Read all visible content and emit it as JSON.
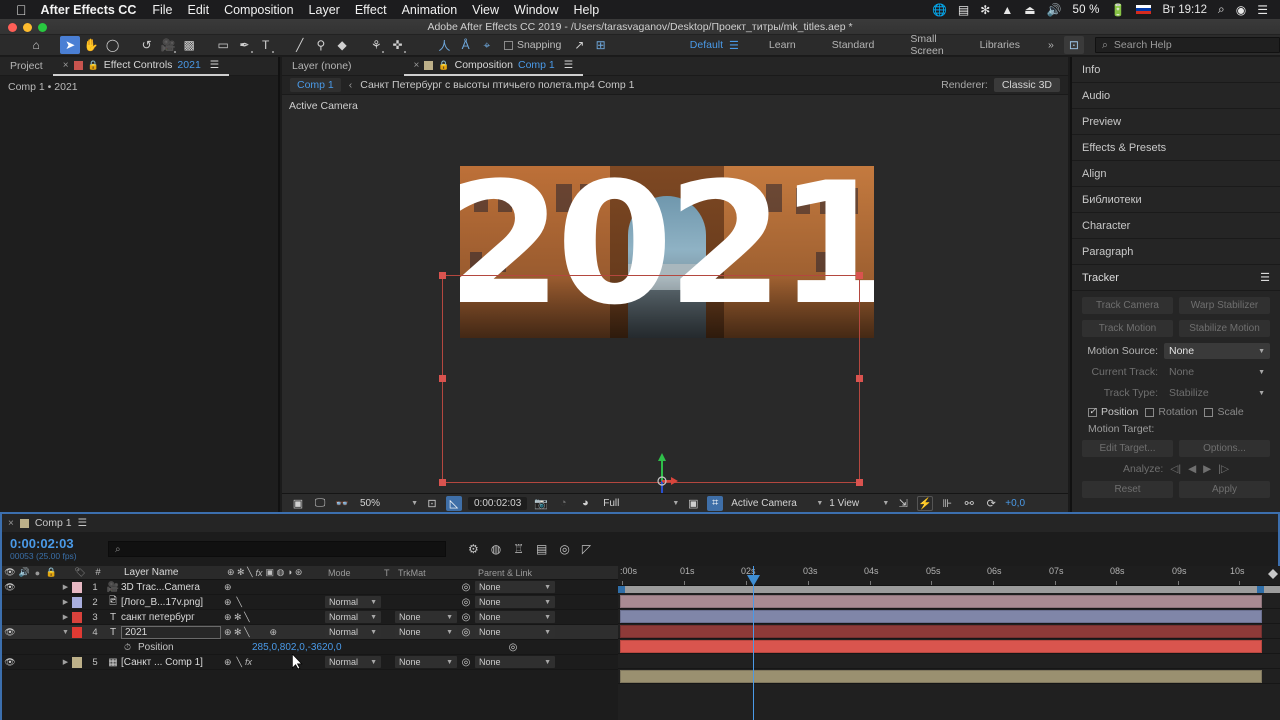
{
  "macbar": {
    "apple_icon": "apple-icon",
    "app_name": "After Effects CC",
    "menus": [
      "File",
      "Edit",
      "Composition",
      "Layer",
      "Effect",
      "Animation",
      "View",
      "Window",
      "Help"
    ],
    "battery": "50 %",
    "time": "Вт 19:12",
    "status_icons": [
      "globe-icon",
      "dropbox-icon",
      "bluetooth-icon",
      "wifi-icon",
      "eject-icon",
      "volume-icon",
      "battery-icon",
      "flag-icon",
      "clock-icon",
      "spotlight-icon",
      "siri-icon",
      "notifications-icon"
    ]
  },
  "titlebar": {
    "title": "Adobe After Effects CC 2019 - /Users/tarasvaganov/Desktop/Проект_титры/mk_titles.aep *"
  },
  "toolbar": {
    "tools": [
      {
        "name": "home-tool",
        "glyph": "⌂"
      },
      {
        "name": "selection-tool",
        "glyph": "➤",
        "selected": true
      },
      {
        "name": "hand-tool",
        "glyph": "✋"
      },
      {
        "name": "zoom-tool",
        "glyph": "⌕"
      },
      {
        "name": "rotation-tool",
        "glyph": "↺"
      },
      {
        "name": "camera-tool",
        "glyph": "🎥"
      },
      {
        "name": "pan-behind-tool",
        "glyph": "✥"
      },
      {
        "name": "shape-tool",
        "glyph": "▭"
      },
      {
        "name": "pen-tool",
        "glyph": "✎"
      },
      {
        "name": "type-tool",
        "glyph": "T"
      },
      {
        "name": "brush-tool",
        "glyph": "/"
      },
      {
        "name": "clone-stamp-tool",
        "glyph": "⚲"
      },
      {
        "name": "eraser-tool",
        "glyph": "◆"
      },
      {
        "name": "roto-brush-tool",
        "glyph": "⚘"
      },
      {
        "name": "puppet-pin-tool",
        "glyph": "✜"
      }
    ],
    "tools_3d": [
      {
        "name": "unified-camera-icon",
        "glyph": "人"
      },
      {
        "name": "orbit-camera-icon",
        "glyph": "Å"
      },
      {
        "name": "track-camera-icon",
        "glyph": "⌖"
      }
    ],
    "snapping_label": "Snapping",
    "snapping_checked": false,
    "extra_icons": [
      {
        "name": "snap-line-icon",
        "glyph": "↗"
      },
      {
        "name": "snap-grid-icon",
        "glyph": "⊞"
      }
    ],
    "workspaces": [
      {
        "label": "Default",
        "active": true
      },
      {
        "label": "Learn",
        "active": false
      },
      {
        "label": "Standard",
        "active": false
      },
      {
        "label": "Small Screen",
        "active": false
      },
      {
        "label": "Libraries",
        "active": false
      }
    ],
    "overflow": "»",
    "search_placeholder": "Search Help"
  },
  "project_panel": {
    "tabs": [
      {
        "label": "Project",
        "active": false,
        "closeable": false
      },
      {
        "label": "Effect Controls",
        "suffix": "2021",
        "active": true,
        "closeable": true
      }
    ],
    "subtitle": "Comp 1 • 2021"
  },
  "comp_panel": {
    "tabs": [
      {
        "label": "Layer (none)",
        "active": false
      },
      {
        "label": "Composition",
        "suffix": "Comp 1",
        "active": true
      }
    ],
    "breadcrumb_pill": "Comp 1",
    "breadcrumb_chevron": "‹",
    "breadcrumb_path": "Санкт Петербург с высоты птичьего полета.mp4 Comp 1",
    "renderer_label": "Renderer:",
    "renderer_value": "Classic 3D",
    "active_camera_label": "Active Camera",
    "stage_text": "2021",
    "toolbar": {
      "zoom": "50%",
      "time": "0:00:02:03",
      "resolution": "Full",
      "view_camera": "Active Camera",
      "views": "1 View",
      "offset": "+0,0",
      "icons": [
        "always-preview-icon",
        "monitor-icon",
        "3d-glasses-icon",
        "region-of-interest-icon",
        "transparency-grid-icon",
        "snapshot-icon",
        "show-snapshot-icon",
        "channel-icon",
        "toggle-mask-icon",
        "toggle-view-layout-icon",
        "pixel-aspect-icon",
        "fast-preview-icon",
        "timeline-icon",
        "comp-flowchart-icon",
        "reset-exposure-icon"
      ]
    }
  },
  "sidebar": {
    "panels": [
      {
        "label": "Info"
      },
      {
        "label": "Audio"
      },
      {
        "label": "Preview"
      },
      {
        "label": "Effects & Presets"
      },
      {
        "label": "Align"
      },
      {
        "label": "Библиотеки"
      },
      {
        "label": "Character"
      },
      {
        "label": "Paragraph"
      }
    ],
    "tracker": {
      "title": "Tracker",
      "menu_icon": "panel-menu-icon",
      "buttons_row1": [
        "Track Camera",
        "Warp Stabilizer"
      ],
      "buttons_row2": [
        "Track Motion",
        "Stabilize Motion"
      ],
      "motion_source_label": "Motion Source:",
      "motion_source_value": "None",
      "current_track_label": "Current Track:",
      "current_track_value": "None",
      "track_type_label": "Track Type:",
      "track_type_value": "Stabilize",
      "checkboxes": [
        {
          "label": "Position",
          "checked": true
        },
        {
          "label": "Rotation",
          "checked": false
        },
        {
          "label": "Scale",
          "checked": false
        }
      ],
      "motion_target_label": "Motion Target:",
      "edit_target": "Edit Target...",
      "options": "Options...",
      "analyze_label": "Analyze:",
      "reset": "Reset",
      "apply": "Apply"
    }
  },
  "timeline": {
    "tab_label": "Comp 1",
    "current_time": "0:00:02:03",
    "frame_info": "00053 (25.00 fps)",
    "search_placeholder": "",
    "header_icons": [
      "motion-blur-icon",
      "graph-editor-icon",
      "brainstorm-icon",
      "comp-flowchart-icon",
      "draft-3d-icon",
      "hide-shy-icon"
    ],
    "columns": {
      "layer_name": "Layer Name",
      "hash": "#",
      "mode": "Mode",
      "t": "T",
      "trkmat": "TrkMat",
      "parent": "Parent & Link"
    },
    "layers": [
      {
        "index": "1",
        "name": "3D Trac...Camera",
        "type_icon": "camera-icon",
        "color": "#e8b9c4",
        "visible": true,
        "expanded": false,
        "selected": false,
        "mode": "",
        "trkmat": "",
        "parent": "None",
        "bar_color": "#a98a92",
        "has_mode": false,
        "has_trkmat": false
      },
      {
        "index": "2",
        "name": "[Лого_В...17v.png]",
        "type_icon": "image-icon",
        "color": "#a8aede",
        "visible": false,
        "expanded": false,
        "selected": false,
        "mode": "Normal",
        "trkmat": "",
        "parent": "None",
        "bar_color": "#8086a8",
        "has_mode": true,
        "has_trkmat": false
      },
      {
        "index": "3",
        "name": "санкт петербург",
        "type_icon": "text-icon",
        "color": "#d9423c",
        "visible": false,
        "expanded": false,
        "selected": false,
        "mode": "Normal",
        "trkmat": "None",
        "parent": "None",
        "bar_color": "#8e3a38",
        "has_mode": true,
        "has_trkmat": true
      },
      {
        "index": "4",
        "name": "2021",
        "type_icon": "text-icon",
        "color": "#e03a33",
        "visible": true,
        "expanded": true,
        "selected": true,
        "mode": "Normal",
        "trkmat": "None",
        "parent": "None",
        "bar_color": "#d9554e",
        "has_mode": true,
        "has_trkmat": true,
        "property": {
          "name": "Position",
          "value": "285,0,802,0,-3620,0",
          "stopwatch_icon": "stopwatch-icon"
        }
      },
      {
        "index": "5",
        "name": "[Санкт ... Comp 1]",
        "type_icon": "comp-icon",
        "color": "#bdb089",
        "visible": true,
        "expanded": false,
        "selected": false,
        "mode": "Normal",
        "trkmat": "None",
        "parent": "None",
        "bar_color": "#9a9070",
        "has_mode": true,
        "has_trkmat": true
      }
    ],
    "ruler_ticks": [
      ":00s",
      "01s",
      "02s",
      "03s",
      "04s",
      "05s",
      "06s",
      "07s",
      "08s",
      "09s",
      "10s"
    ],
    "playhead_time_label": "02s"
  }
}
